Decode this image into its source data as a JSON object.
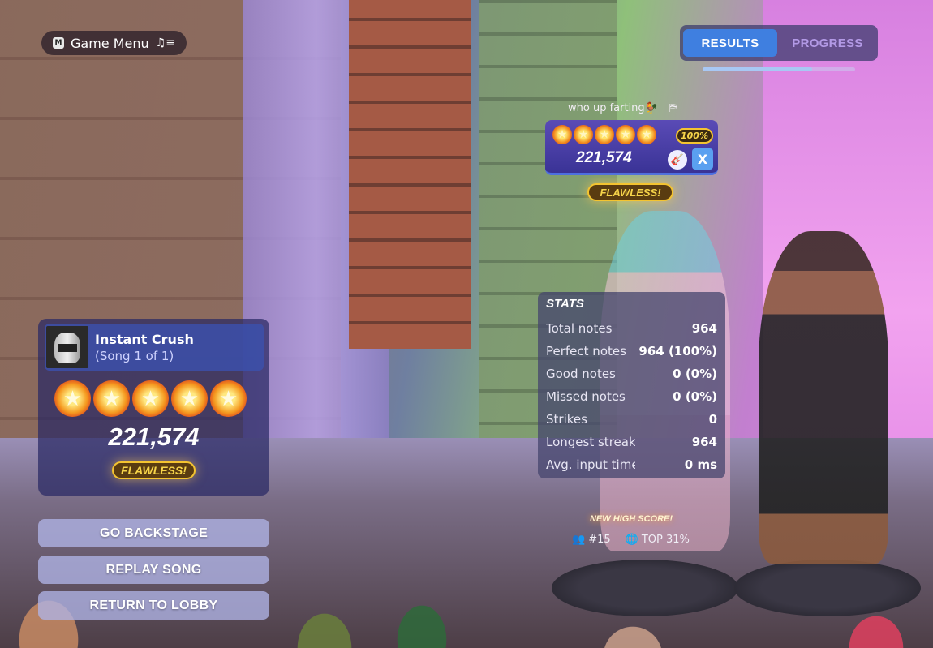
{
  "menu": {
    "key": "M",
    "label": "Game Menu"
  },
  "tabs": [
    {
      "label": "RESULTS",
      "active": true
    },
    {
      "label": "PROGRESS",
      "active": false
    }
  ],
  "tab_progress": 0.72,
  "player": {
    "name": "who up farting🐓",
    "stars": 5,
    "accuracy": "100%",
    "score": "221,574",
    "badge": "X",
    "rating": "FLAWLESS!"
  },
  "song": {
    "title": "Instant Crush",
    "subtitle": "(Song 1 of 1)",
    "stars": 5,
    "score": "221,574",
    "rating": "FLAWLESS!"
  },
  "buttons": {
    "backstage": "GO BACKSTAGE",
    "replay": "REPLAY SONG",
    "lobby": "RETURN TO LOBBY"
  },
  "stats": {
    "title": "STATS",
    "rows": [
      {
        "label": "Total notes",
        "value": "964"
      },
      {
        "label": "Perfect notes",
        "value": "964 (100%)"
      },
      {
        "label": "Good notes",
        "value": "0 (0%)"
      },
      {
        "label": "Missed notes",
        "value": "0 (0%)"
      },
      {
        "label": "Strikes",
        "value": "0"
      },
      {
        "label": "Longest streak",
        "value": "964"
      },
      {
        "label": "Avg. input time",
        "value": "0 ms"
      }
    ]
  },
  "high_score": {
    "label": "NEW HIGH SCORE!",
    "rank": "#15",
    "top": "TOP 31%"
  },
  "colors": {
    "accent_blue": "#3f7fe0",
    "gold": "#f4c430",
    "panel": "#3a3396"
  },
  "icons": [
    "menu-key-icon",
    "music-queue-icon",
    "emote-icon",
    "star-icon",
    "guitar-icon",
    "friends-icon",
    "globe-icon"
  ]
}
